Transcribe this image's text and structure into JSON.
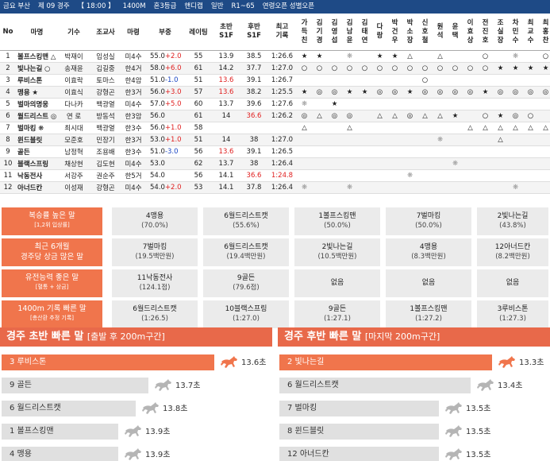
{
  "header": {
    "items": [
      "금요 부산",
      "제 09 경주",
      "【 18:00 】",
      "1400M",
      "혼3등급",
      "핸디캡",
      "일반",
      "R1~65",
      "연령오픈 성별오픈"
    ]
  },
  "table": {
    "columns": [
      "No",
      "마명",
      "기수",
      "조교사",
      "마령",
      "부중",
      "레이팅",
      "초반 S1F",
      "후반 S1F",
      "최고 기록"
    ],
    "col_s1f_early": [
      "초반",
      "S1F"
    ],
    "col_s1f_late": [
      "후반",
      "S1F"
    ],
    "col_best": [
      "최고",
      "기록"
    ],
    "factors": [
      [
        "가",
        "득",
        "친"
      ],
      [
        "김",
        "기",
        "경"
      ],
      [
        "김",
        "영",
        "섭"
      ],
      [
        "김",
        "남",
        "윤"
      ],
      [
        "김",
        "태",
        "연"
      ],
      [
        "다",
        "랑"
      ],
      [
        "박",
        "건",
        "우"
      ],
      [
        "박",
        "소",
        "장"
      ],
      [
        "신",
        "호",
        "철"
      ],
      [
        "원",
        "석"
      ],
      [
        "윤",
        "택"
      ],
      [
        "이",
        "효",
        "상"
      ],
      [
        "전",
        "진",
        "호"
      ],
      [
        "조",
        "실",
        "장"
      ],
      [
        "차",
        "민",
        "수"
      ],
      [
        "최",
        "교",
        "수"
      ],
      [
        "최",
        "홍",
        "찬"
      ]
    ],
    "rows": [
      {
        "no": "1",
        "name": "볼프스킹맨",
        "mark": "△",
        "jockey": "박재이",
        "trainer": "임성실",
        "age": "미4수",
        "wt": "55.0",
        "wd": "+2.0",
        "rating": "55",
        "s1": "13.9",
        "s1hi": false,
        "s2": "38.5",
        "s2hi": false,
        "best": "1:26.6",
        "besthi": false,
        "f": [
          "★",
          "★",
          "",
          "❋",
          "",
          "★",
          "★",
          "△",
          "",
          "△",
          "",
          "",
          "○",
          "",
          "❋",
          "",
          "○"
        ]
      },
      {
        "no": "2",
        "name": "빛나는길",
        "mark": "○",
        "jockey": "송재윤",
        "trainer": "김길중",
        "age": "한4거",
        "wt": "58.0",
        "wd": "+6.0",
        "rating": "61",
        "s1": "14.2",
        "s1hi": false,
        "s2": "37.7",
        "s2hi": false,
        "best": "1:27.0",
        "besthi": false,
        "f": [
          "○",
          "○",
          "○",
          "○",
          "○",
          "○",
          "○",
          "○",
          "○",
          "○",
          "○",
          "○",
          "○",
          "★",
          "★",
          "★",
          "★"
        ]
      },
      {
        "no": "3",
        "name": "루비스톤",
        "mark": "",
        "jockey": "이효락",
        "trainer": "토마스",
        "age": "한4암",
        "wt": "51.0",
        "wd": "-1.0",
        "rating": "51",
        "s1": "13.6",
        "s1hi": true,
        "s2": "39.1",
        "s2hi": false,
        "best": "1:26.7",
        "besthi": false,
        "f": [
          "",
          "",
          "",
          "",
          "",
          "",
          "",
          "",
          "○",
          "",
          "",
          "",
          "",
          "",
          "",
          "",
          ""
        ]
      },
      {
        "no": "4",
        "name": "맹용",
        "mark": "★",
        "jockey": "이효식",
        "trainer": "강형곤",
        "age": "한3거",
        "wt": "56.0",
        "wd": "+3.0",
        "rating": "57",
        "s1": "13.6",
        "s1hi": true,
        "s2": "38.2",
        "s2hi": false,
        "best": "1:25.5",
        "besthi": false,
        "f": [
          "★",
          "◎",
          "◎",
          "★",
          "★",
          "◎",
          "◎",
          "★",
          "◎",
          "◎",
          "◎",
          "◎",
          "★",
          "◎",
          "◎",
          "◎",
          "◎"
        ]
      },
      {
        "no": "5",
        "name": "벌마의명웅",
        "mark": "",
        "jockey": "다나카",
        "trainer": "백광열",
        "age": "미4수",
        "wt": "57.0",
        "wd": "+5.0",
        "rating": "60",
        "s1": "13.7",
        "s1hi": false,
        "s2": "39.6",
        "s2hi": false,
        "best": "1:27.6",
        "besthi": false,
        "f": [
          "❋",
          "",
          "★",
          "",
          "",
          "",
          "",
          "",
          "",
          "",
          "",
          "",
          "",
          "",
          "",
          "",
          ""
        ]
      },
      {
        "no": "6",
        "name": "월드리스트",
        "mark": "◎",
        "jockey": "연  로",
        "trainer": "방동석",
        "age": "한3암",
        "wt": "56.0",
        "wd": "",
        "rating": "61",
        "s1": "14",
        "s1hi": false,
        "s2": "36.6",
        "s2hi": true,
        "best": "1:26.2",
        "besthi": false,
        "f": [
          "◎",
          "△",
          "◎",
          "◎",
          "",
          "△",
          "△",
          "◎",
          "△",
          "△",
          "★",
          "",
          "○",
          "★",
          "◎",
          "○",
          ""
        ]
      },
      {
        "no": "7",
        "name": "벌마킹",
        "mark": "❋",
        "jockey": "최시대",
        "trainer": "백광열",
        "age": "한3수",
        "wt": "56.0",
        "wd": "+1.0",
        "rating": "58",
        "s1": "",
        "s1hi": false,
        "s2": "",
        "s2hi": false,
        "best": "",
        "besthi": false,
        "f": [
          "△",
          "",
          "",
          "△",
          "",
          "",
          "",
          "",
          "",
          "",
          "",
          "△",
          "△",
          "△",
          "△",
          "△",
          "△"
        ]
      },
      {
        "no": "8",
        "name": "윈드블릿",
        "mark": "",
        "jockey": "모준호",
        "trainer": "민장기",
        "age": "한3거",
        "wt": "53.0",
        "wd": "+1.0",
        "rating": "51",
        "s1": "14",
        "s1hi": false,
        "s2": "38",
        "s2hi": false,
        "best": "1:27.0",
        "besthi": false,
        "f": [
          "",
          "",
          "",
          "",
          "",
          "",
          "",
          "",
          "",
          "❋",
          "",
          "",
          "",
          "△",
          "",
          "",
          ""
        ]
      },
      {
        "no": "9",
        "name": "골든",
        "mark": "",
        "jockey": "남정혁",
        "trainer": "조용배",
        "age": "한3수",
        "wt": "51.0",
        "wd": "-3.0",
        "rating": "56",
        "s1": "13.6",
        "s1hi": true,
        "s2": "39.1",
        "s2hi": false,
        "best": "1:26.5",
        "besthi": false,
        "f": [
          "",
          "",
          "",
          "",
          "",
          "",
          "",
          "",
          "",
          "",
          "",
          "",
          "",
          "",
          "",
          "",
          ""
        ]
      },
      {
        "no": "10",
        "name": "블랙스프링",
        "mark": "",
        "jockey": "채상현",
        "trainer": "김도현",
        "age": "미4수",
        "wt": "53.0",
        "wd": "",
        "rating": "62",
        "s1": "13.7",
        "s1hi": false,
        "s2": "38",
        "s2hi": false,
        "best": "1:26.4",
        "besthi": false,
        "f": [
          "",
          "",
          "",
          "",
          "",
          "",
          "",
          "",
          "",
          "",
          "❋",
          "",
          "",
          "",
          "",
          "",
          ""
        ]
      },
      {
        "no": "11",
        "name": "낙동전사",
        "mark": "",
        "jockey": "서강주",
        "trainer": "권순주",
        "age": "한5거",
        "wt": "54.0",
        "wd": "",
        "rating": "56",
        "s1": "14.1",
        "s1hi": false,
        "s2": "36.6",
        "s2hi": true,
        "best": "1:24.8",
        "besthi": true,
        "f": [
          "",
          "",
          "",
          "",
          "",
          "",
          "",
          "❋",
          "",
          "",
          "",
          "",
          "",
          "",
          "",
          "",
          ""
        ]
      },
      {
        "no": "12",
        "name": "아너드칸",
        "mark": "",
        "jockey": "이성재",
        "trainer": "강형곤",
        "age": "미4수",
        "wt": "54.0",
        "wd": "+2.0",
        "rating": "53",
        "s1": "14.1",
        "s1hi": false,
        "s2": "37.8",
        "s2hi": false,
        "best": "1:26.4",
        "besthi": false,
        "f": [
          "❋",
          "",
          "",
          "❋",
          "",
          "",
          "",
          "",
          "",
          "",
          "",
          "",
          "",
          "",
          "❋",
          "",
          ""
        ]
      }
    ]
  },
  "summary": [
    {
      "label": "복승률 높은 말",
      "sub": "[1,2위 입상률]",
      "single": false,
      "cells": [
        [
          "4맹용",
          "(70.0%)"
        ],
        [
          "6월드리스트캣",
          "(55.6%)"
        ],
        [
          "1볼프스킹맨",
          "(50.0%)"
        ],
        [
          "7벌마킹",
          "(50.0%)"
        ],
        [
          "2빛나는길",
          "(43.8%)"
        ]
      ]
    },
    {
      "label": "최근 6개월",
      "sub": "경주당 상금 많은 말",
      "subBig": true,
      "single": false,
      "cells": [
        [
          "7벌마킹",
          "(19.5백만원)"
        ],
        [
          "6월드리스트캣",
          "(19.4백만원)"
        ],
        [
          "2빛나는길",
          "(10.5백만원)"
        ],
        [
          "4맹용",
          "(8.3백만원)"
        ],
        [
          "12아너드칸",
          "(8.2백만원)"
        ]
      ]
    },
    {
      "label": "유전능력 좋은 말",
      "sub": "[혈통 + 상금]",
      "single": false,
      "cells": [
        [
          "11낙동전사",
          "(124.1점)"
        ],
        [
          "9골든",
          "(79.6점)"
        ],
        [
          "없음",
          ""
        ],
        [
          "없음",
          ""
        ],
        [
          "없음",
          ""
        ]
      ]
    },
    {
      "label": "1400m 기록 빠른 말",
      "sub": "[총산환 추정 기록]",
      "single": false,
      "cells": [
        [
          "6월드리스트캣",
          "(1:26.5)"
        ],
        [
          "10블랙스프링",
          "(1:27.0)"
        ],
        [
          "9골든",
          "(1:27.1)"
        ],
        [
          "1볼프스킹맨",
          "(1:27.2)"
        ],
        [
          "3루비스톤",
          "(1:27.3)"
        ]
      ]
    }
  ],
  "early": {
    "title": "경주 초반 빠른 말",
    "subtitle": "[출발 후 200m구간]",
    "rows": [
      {
        "label": "3 루비스톤",
        "value": "13.6초",
        "frac": 1.0,
        "first": true
      },
      {
        "label": "9 골든",
        "value": "13.7초",
        "frac": 0.69,
        "first": false
      },
      {
        "label": "6 월드리스트캣",
        "value": "13.8초",
        "frac": 0.63,
        "first": false
      },
      {
        "label": "1 볼프스킹맨",
        "value": "13.9초",
        "frac": 0.55,
        "first": false
      },
      {
        "label": "4 맹용",
        "value": "13.9초",
        "frac": 0.55,
        "first": false
      }
    ]
  },
  "late": {
    "title": "경주 후반 빠른 말",
    "subtitle": "[마지막 200m구간]",
    "rows": [
      {
        "label": "2 빛나는길",
        "value": "13.3초",
        "frac": 1.0,
        "first": true
      },
      {
        "label": "6 월드리스트캣",
        "value": "13.4초",
        "frac": 0.9,
        "first": false
      },
      {
        "label": "7 벌마킹",
        "value": "13.5초",
        "frac": 0.75,
        "first": false
      },
      {
        "label": "8 윈드블릿",
        "value": "13.5초",
        "frac": 0.75,
        "first": false
      },
      {
        "label": "12 아너드칸",
        "value": "13.5초",
        "frac": 0.75,
        "first": false
      }
    ]
  },
  "colors": {
    "header": "#1e4a86",
    "accent": "#f0754c",
    "plus": "#e02020",
    "minus": "#1a46c4"
  }
}
